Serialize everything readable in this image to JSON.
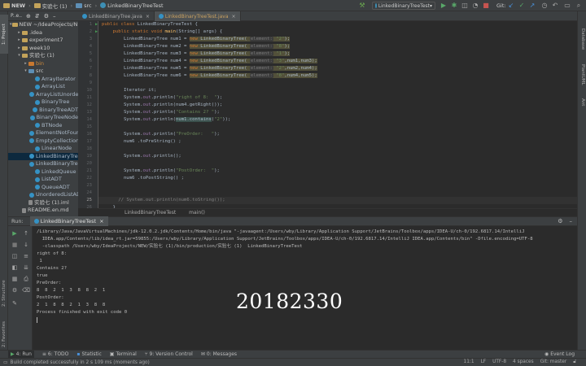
{
  "navbar": {
    "crumbs": [
      "NEW",
      "实验七 (1)",
      "src",
      "LinkedBinaryTreeTest"
    ],
    "run_config": "LinkedBinaryTreeTest",
    "git_label": "Git:"
  },
  "project_panel": {
    "title": "P..e..",
    "tree": [
      {
        "label": "NEW  ~/IdeaProjects/NEW",
        "kind": "folder",
        "depth": 0,
        "arrow": "▾"
      },
      {
        "label": ".idea",
        "kind": "folder",
        "depth": 1,
        "arrow": "▸"
      },
      {
        "label": "experiment7",
        "kind": "folder",
        "depth": 1,
        "arrow": "▸"
      },
      {
        "label": "week10",
        "kind": "folder",
        "depth": 1,
        "arrow": "▸"
      },
      {
        "label": "实验七 (1)",
        "kind": "folder",
        "depth": 1,
        "arrow": "▾"
      },
      {
        "label": "bin",
        "kind": "folder-orange",
        "depth": 2,
        "arrow": "▸"
      },
      {
        "label": "src",
        "kind": "folder-blue",
        "depth": 2,
        "arrow": "▾"
      },
      {
        "label": "ArrayIterator",
        "kind": "class",
        "depth": 3
      },
      {
        "label": "ArrayList",
        "kind": "class",
        "depth": 3
      },
      {
        "label": "ArrayListUnordered",
        "kind": "class",
        "depth": 3
      },
      {
        "label": "BinaryTree",
        "kind": "class",
        "depth": 3
      },
      {
        "label": "BinaryTreeADT",
        "kind": "class",
        "depth": 3
      },
      {
        "label": "BinaryTreeNode",
        "kind": "class",
        "depth": 3
      },
      {
        "label": "BTNode",
        "kind": "class",
        "depth": 3
      },
      {
        "label": "ElementNotFoundException",
        "kind": "class",
        "depth": 3
      },
      {
        "label": "EmptyCollectionException",
        "kind": "class",
        "depth": 3
      },
      {
        "label": "LinearNode",
        "kind": "class",
        "depth": 3
      },
      {
        "label": "LinkedBinaryTree",
        "kind": "class",
        "depth": 3,
        "selected": true
      },
      {
        "label": "LinkedBinaryTreeTest",
        "kind": "class",
        "depth": 3
      },
      {
        "label": "LinkedQueue",
        "kind": "class",
        "depth": 3
      },
      {
        "label": "ListADT",
        "kind": "class",
        "depth": 3
      },
      {
        "label": "QueueADT",
        "kind": "class",
        "depth": 3
      },
      {
        "label": "UnorderedListADT",
        "kind": "class",
        "depth": 3
      },
      {
        "label": "实验七 (1).iml",
        "kind": "file",
        "depth": 2
      },
      {
        "label": "README.en.md",
        "kind": "file",
        "depth": 1
      }
    ]
  },
  "editor": {
    "tabs": [
      {
        "label": "LinkedBinaryTree.java",
        "active": false
      },
      {
        "label": "LinkedBinaryTreeTest.java",
        "active": true
      }
    ],
    "line_numbers": [
      "",
      "",
      "",
      "",
      "",
      "",
      "",
      "",
      "",
      "",
      "",
      "",
      "",
      "",
      "",
      "",
      "",
      "",
      "",
      "",
      "",
      "",
      "",
      "",
      "",
      ""
    ],
    "breadcrumb": [
      "LinkedBinaryTreeTest",
      "main()"
    ]
  },
  "left_stripe": [
    "1: Project",
    "2: Structure",
    "2: Favorites"
  ],
  "right_stripe": [
    "Database",
    "PlantUML",
    "Ant"
  ],
  "run": {
    "label": "Run:",
    "tab": "LinkedBinaryTreeTest",
    "console": [
      "/Library/Java/JavaVirtualMachines/jdk-12.0.2.jdk/Contents/Home/bin/java \"-javaagent:/Users/wby/Library/Application Support/JetBrains/Toolbox/apps/IDEA-U/ch-0/192.6817.14/IntelliJ",
      "  IDEA.app/Contents/lib/idea_rt.jar=59855:/Users/wby/Library/Application Support/JetBrains/Toolbox/apps/IDEA-U/ch-0/192.6817.14/IntelliJ IDEA.app/Contents/bin\" -Dfile.encoding=UTF-8",
      "  -classpath /Users/wby/IdeaProjects/NEW/实验七 (1)/bin/production/实验七 (1)  LinkedBinaryTreeTest",
      "right of 8:",
      " 1",
      "Contains 2?",
      "true",
      "PreOrder:",
      "8  8  2  1  3  8  8  2  1",
      "PostOrder:",
      "2  1  8  8  2  1  3  8  8",
      "Process finished with exit code 0"
    ]
  },
  "overlay_text": "20182330",
  "bottom_toolbar": [
    "4: Run",
    "6: TODO",
    "Statistic",
    "Terminal",
    "9: Version Control",
    "0: Messages",
    "Event Log"
  ],
  "status": {
    "message": "Build completed successfully in 2 s 109 ms (moments ago)",
    "position": "11:1",
    "line_sep": "LF",
    "encoding": "UTF-8",
    "indent": "4 spaces",
    "git": "Git: master"
  }
}
